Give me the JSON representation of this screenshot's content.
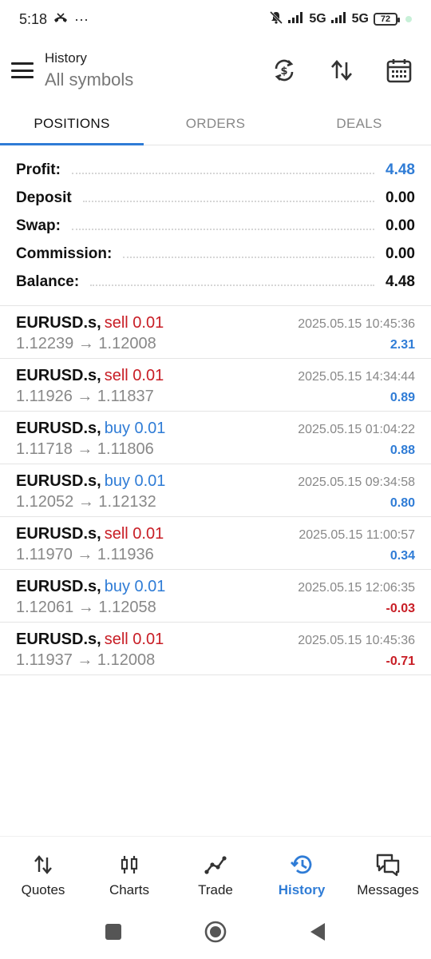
{
  "status_bar": {
    "time": "5:18",
    "dots": "···",
    "network1": "5G",
    "network2": "5G",
    "battery": "72"
  },
  "header": {
    "title": "History",
    "subtitle": "All symbols"
  },
  "tabs": [
    {
      "label": "POSITIONS",
      "active": true
    },
    {
      "label": "ORDERS",
      "active": false
    },
    {
      "label": "DEALS",
      "active": false
    }
  ],
  "summary": {
    "profit": {
      "label": "Profit:",
      "value": "4.48"
    },
    "deposit": {
      "label": "Deposit",
      "value": "0.00"
    },
    "swap": {
      "label": "Swap:",
      "value": "0.00"
    },
    "commission": {
      "label": "Commission:",
      "value": "0.00"
    },
    "balance": {
      "label": "Balance:",
      "value": "4.48"
    }
  },
  "deals": [
    {
      "symbol": "EURUSD.s,",
      "side": "sell 0.01",
      "time": "2025.05.15 10:45:36",
      "prices": "1.12239 → 1.12008",
      "profit": "2.31"
    },
    {
      "symbol": "EURUSD.s,",
      "side": "sell 0.01",
      "time": "2025.05.15 14:34:44",
      "prices": "1.11926 → 1.11837",
      "profit": "0.89"
    },
    {
      "symbol": "EURUSD.s,",
      "side": "buy 0.01",
      "time": "2025.05.15 01:04:22",
      "prices": "1.11718 → 1.11806",
      "profit": "0.88"
    },
    {
      "symbol": "EURUSD.s,",
      "side": "buy 0.01",
      "time": "2025.05.15 09:34:58",
      "prices": "1.12052 → 1.12132",
      "profit": "0.80"
    },
    {
      "symbol": "EURUSD.s,",
      "side": "sell 0.01",
      "time": "2025.05.15 11:00:57",
      "prices": "1.11970 → 1.11936",
      "profit": "0.34"
    },
    {
      "symbol": "EURUSD.s,",
      "side": "buy 0.01",
      "time": "2025.05.15 12:06:35",
      "prices": "1.12061 → 1.12058",
      "profit": "-0.03"
    },
    {
      "symbol": "EURUSD.s,",
      "side": "sell 0.01",
      "time": "2025.05.15 10:45:36",
      "prices": "1.11937 → 1.12008",
      "profit": "-0.71"
    }
  ],
  "bottom_nav": [
    {
      "label": "Quotes",
      "icon": "quotes-icon"
    },
    {
      "label": "Charts",
      "icon": "charts-icon"
    },
    {
      "label": "Trade",
      "icon": "trade-icon"
    },
    {
      "label": "History",
      "icon": "history-icon",
      "active": true
    },
    {
      "label": "Messages",
      "icon": "messages-icon"
    }
  ],
  "colors": {
    "accent": "#2f7cd6",
    "sell": "#c81d25",
    "negative": "#c81d25"
  }
}
